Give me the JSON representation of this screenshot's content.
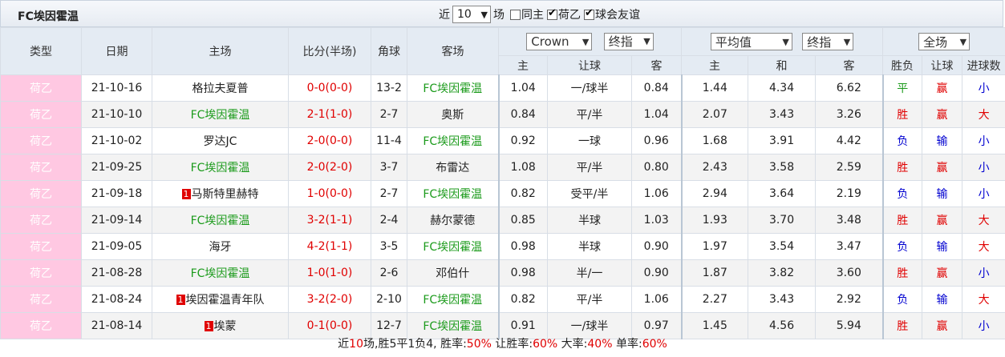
{
  "title": "FC埃因霍温",
  "filters": {
    "recent_prefix": "近",
    "recent_value": "10",
    "recent_suffix": "场",
    "same_home_label": "同主",
    "league_label": "荷乙",
    "friendly_label": "球会友谊"
  },
  "headers": {
    "type": "类型",
    "date": "日期",
    "home": "主场",
    "score": "比分(半场)",
    "corner": "角球",
    "away": "客场",
    "bookie": "Crown",
    "bookie_mode": "终指",
    "avg": "平均值",
    "avg_mode": "终指",
    "result_filter": "全场",
    "sub": [
      "主",
      "让球",
      "客",
      "主",
      "和",
      "客",
      "胜负",
      "让球",
      "进球数"
    ]
  },
  "rows": [
    {
      "league": "荷乙",
      "date": "21-10-16",
      "home": "格拉夫夏普",
      "home_hl": false,
      "home_tag": "",
      "score": "0-0(0-0)",
      "corner": "13-2",
      "away": "FC埃因霍温",
      "away_hl": true,
      "h": "1.04",
      "line": "一/球半",
      "a": "0.84",
      "avg_h": "1.44",
      "avg_d": "4.34",
      "avg_a": "6.62",
      "res": "平",
      "ah": "赢",
      "ou": "小"
    },
    {
      "league": "荷乙",
      "date": "21-10-10",
      "home": "FC埃因霍温",
      "home_hl": true,
      "home_tag": "",
      "score": "2-1(1-0)",
      "corner": "2-7",
      "away": "奥斯",
      "away_hl": false,
      "h": "0.84",
      "line": "平/半",
      "a": "1.04",
      "avg_h": "2.07",
      "avg_d": "3.43",
      "avg_a": "3.26",
      "res": "胜",
      "ah": "赢",
      "ou": "大"
    },
    {
      "league": "荷乙",
      "date": "21-10-02",
      "home": "罗达JC",
      "home_hl": false,
      "home_tag": "",
      "score": "2-0(0-0)",
      "corner": "11-4",
      "away": "FC埃因霍温",
      "away_hl": true,
      "h": "0.92",
      "line": "一球",
      "a": "0.96",
      "avg_h": "1.68",
      "avg_d": "3.91",
      "avg_a": "4.42",
      "res": "负",
      "ah": "输",
      "ou": "小"
    },
    {
      "league": "荷乙",
      "date": "21-09-25",
      "home": "FC埃因霍温",
      "home_hl": true,
      "home_tag": "",
      "score": "2-0(2-0)",
      "corner": "3-7",
      "away": "布雷达",
      "away_hl": false,
      "h": "1.08",
      "line": "平/半",
      "a": "0.80",
      "avg_h": "2.43",
      "avg_d": "3.58",
      "avg_a": "2.59",
      "res": "胜",
      "ah": "赢",
      "ou": "小"
    },
    {
      "league": "荷乙",
      "date": "21-09-18",
      "home": "马斯特里赫特",
      "home_hl": false,
      "home_tag": "1",
      "score": "1-0(0-0)",
      "corner": "2-7",
      "away": "FC埃因霍温",
      "away_hl": true,
      "h": "0.82",
      "line": "受平/半",
      "a": "1.06",
      "avg_h": "2.94",
      "avg_d": "3.64",
      "avg_a": "2.19",
      "res": "负",
      "ah": "输",
      "ou": "小"
    },
    {
      "league": "荷乙",
      "date": "21-09-14",
      "home": "FC埃因霍温",
      "home_hl": true,
      "home_tag": "",
      "score": "3-2(1-1)",
      "corner": "2-4",
      "away": "赫尔蒙德",
      "away_hl": false,
      "h": "0.85",
      "line": "半球",
      "a": "1.03",
      "avg_h": "1.93",
      "avg_d": "3.70",
      "avg_a": "3.48",
      "res": "胜",
      "ah": "赢",
      "ou": "大"
    },
    {
      "league": "荷乙",
      "date": "21-09-05",
      "home": "海牙",
      "home_hl": false,
      "home_tag": "",
      "score": "4-2(1-1)",
      "corner": "3-5",
      "away": "FC埃因霍温",
      "away_hl": true,
      "h": "0.98",
      "line": "半球",
      "a": "0.90",
      "avg_h": "1.97",
      "avg_d": "3.54",
      "avg_a": "3.47",
      "res": "负",
      "ah": "输",
      "ou": "大"
    },
    {
      "league": "荷乙",
      "date": "21-08-28",
      "home": "FC埃因霍温",
      "home_hl": true,
      "home_tag": "",
      "score": "1-0(1-0)",
      "corner": "2-6",
      "away": "邓伯什",
      "away_hl": false,
      "h": "0.98",
      "line": "半/一",
      "a": "0.90",
      "avg_h": "1.87",
      "avg_d": "3.82",
      "avg_a": "3.60",
      "res": "胜",
      "ah": "赢",
      "ou": "小"
    },
    {
      "league": "荷乙",
      "date": "21-08-24",
      "home": "埃因霍温青年队",
      "home_hl": false,
      "home_tag": "1",
      "score": "3-2(2-0)",
      "corner": "2-10",
      "away": "FC埃因霍温",
      "away_hl": true,
      "h": "0.82",
      "line": "平/半",
      "a": "1.06",
      "avg_h": "2.27",
      "avg_d": "3.43",
      "avg_a": "2.92",
      "res": "负",
      "ah": "输",
      "ou": "大"
    },
    {
      "league": "荷乙",
      "date": "21-08-14",
      "home": "埃蒙",
      "home_hl": false,
      "home_tag": "1",
      "score": "0-1(0-0)",
      "corner": "12-7",
      "away": "FC埃因霍温",
      "away_hl": true,
      "h": "0.91",
      "line": "一/球半",
      "a": "0.97",
      "avg_h": "1.45",
      "avg_d": "4.56",
      "avg_a": "5.94",
      "res": "胜",
      "ah": "赢",
      "ou": "小"
    }
  ],
  "summary": {
    "p1": "近",
    "n": "10",
    "p2": "场,胜5平1负4, 胜率:",
    "win_rate": "50%",
    "p3": " 让胜率:",
    "ah_rate": "60%",
    "p4": " 大率:",
    "over_rate": "40%",
    "p5": " 单率:",
    "odd_rate": "60%"
  },
  "colors": {
    "win": "#e00000",
    "draw": "#1c9b1c",
    "loss": "#0000d0",
    "league_bg": "#ffc8e2"
  }
}
